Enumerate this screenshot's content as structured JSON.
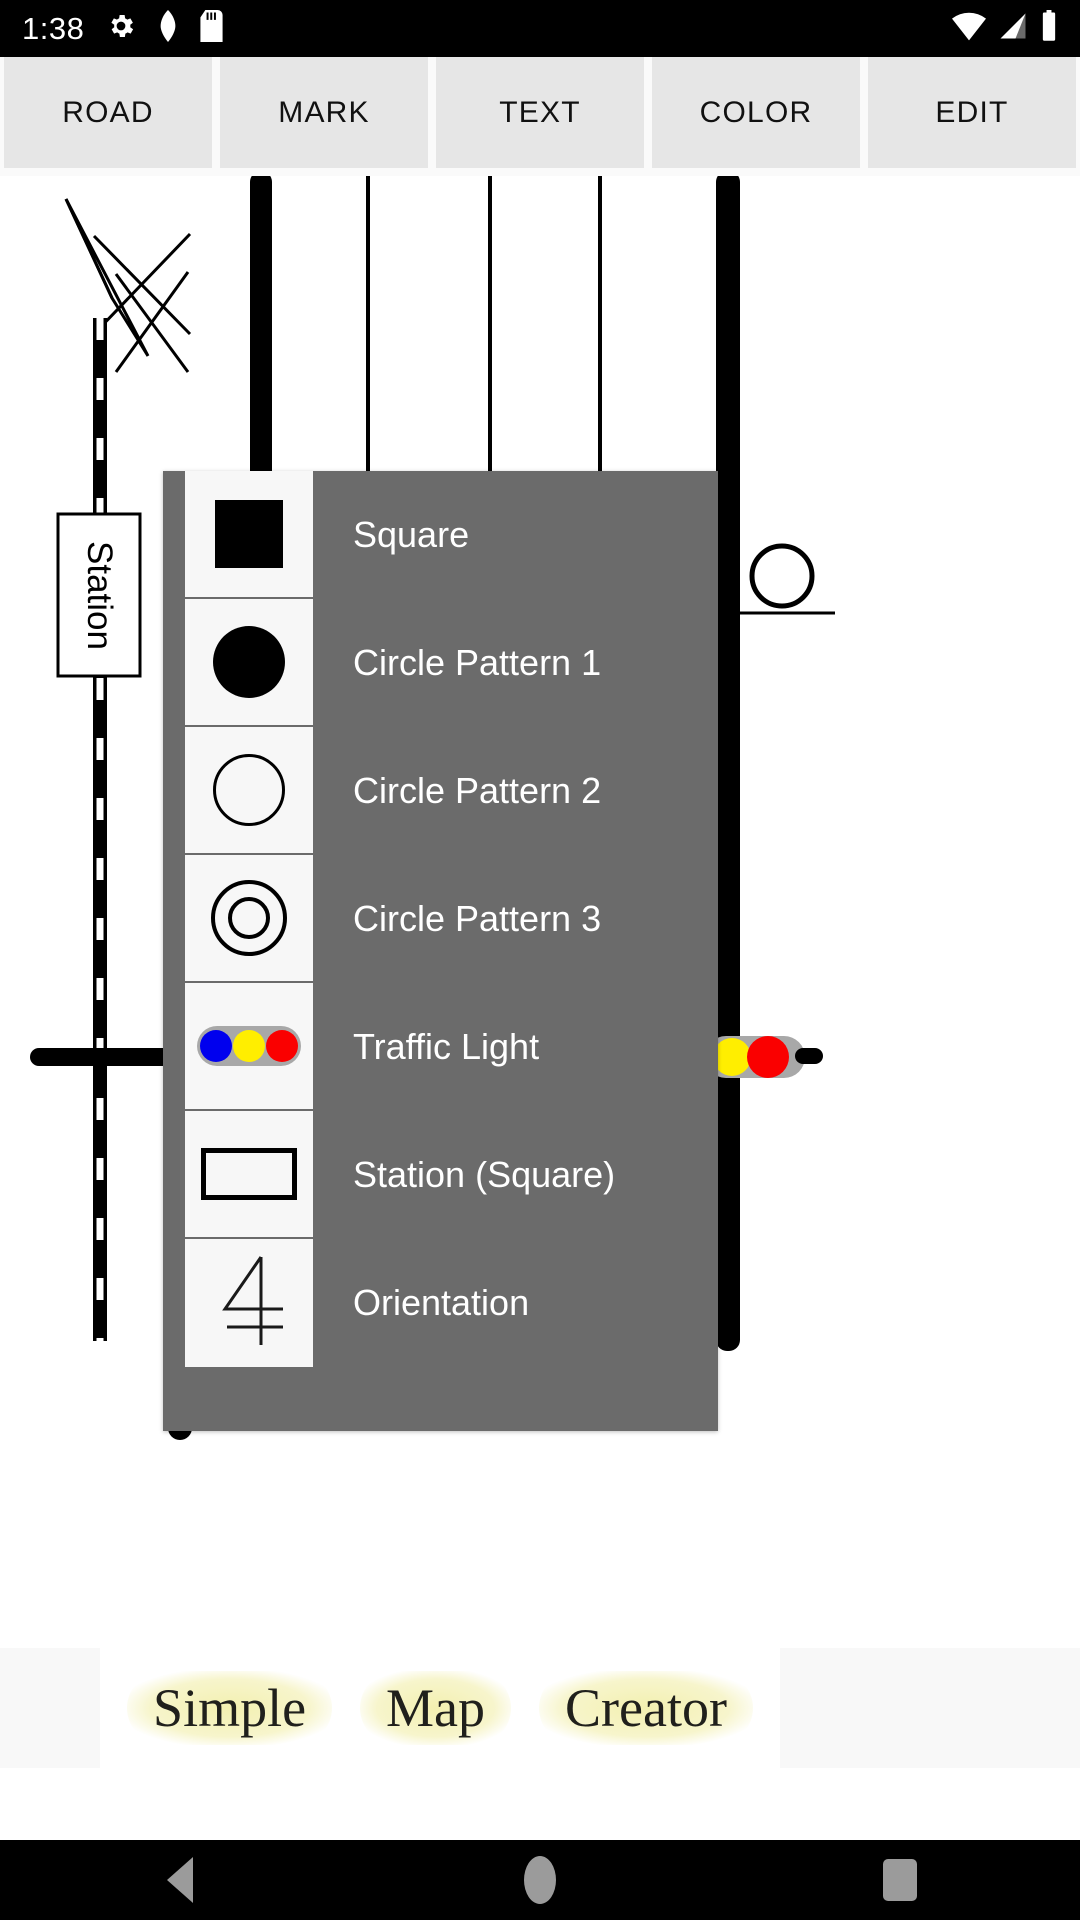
{
  "status_bar": {
    "clock": "1:38",
    "left_icons": [
      "gear-icon",
      "shield-icon",
      "sd-card-icon"
    ],
    "right_icons": [
      "wifi-icon",
      "cellular-signal-icon",
      "battery-icon"
    ],
    "background": "#000000",
    "foreground": "#ffffff"
  },
  "tabs": [
    {
      "label": "ROAD"
    },
    {
      "label": "MARK"
    },
    {
      "label": "TEXT"
    },
    {
      "label": "COLOR"
    },
    {
      "label": "EDIT"
    }
  ],
  "menu": {
    "background": "#6b6b6b",
    "text_color": "#ffffff",
    "items": [
      {
        "label": "Square",
        "icon": "filled-square-icon"
      },
      {
        "label": "Circle Pattern 1",
        "icon": "filled-circle-icon"
      },
      {
        "label": "Circle Pattern 2",
        "icon": "outline-circle-icon"
      },
      {
        "label": "Circle Pattern 3",
        "icon": "double-circle-icon"
      },
      {
        "label": "Traffic Light",
        "icon": "traffic-light-icon"
      },
      {
        "label": "Station (Square)",
        "icon": "station-rectangle-icon"
      },
      {
        "label": "Orientation",
        "icon": "orientation-north-icon"
      }
    ]
  },
  "traffic_light_colors": {
    "blue": "#0000ee",
    "yellow": "#ffee00",
    "red": "#fa0000",
    "housing": "#a8a8a8"
  },
  "map": {
    "station_label": "Station",
    "road_color": "#000000",
    "background": "#ffffff"
  },
  "watermark": {
    "words": [
      "Simple",
      "Map",
      "Creator"
    ],
    "highlight_color": "#f3f0b0",
    "text_color": "#20201c"
  },
  "nav_bar": {
    "buttons": [
      {
        "name": "back",
        "icon": "triangle-back-icon"
      },
      {
        "name": "home",
        "icon": "circle-home-icon"
      },
      {
        "name": "recents",
        "icon": "square-recents-icon"
      }
    ]
  }
}
